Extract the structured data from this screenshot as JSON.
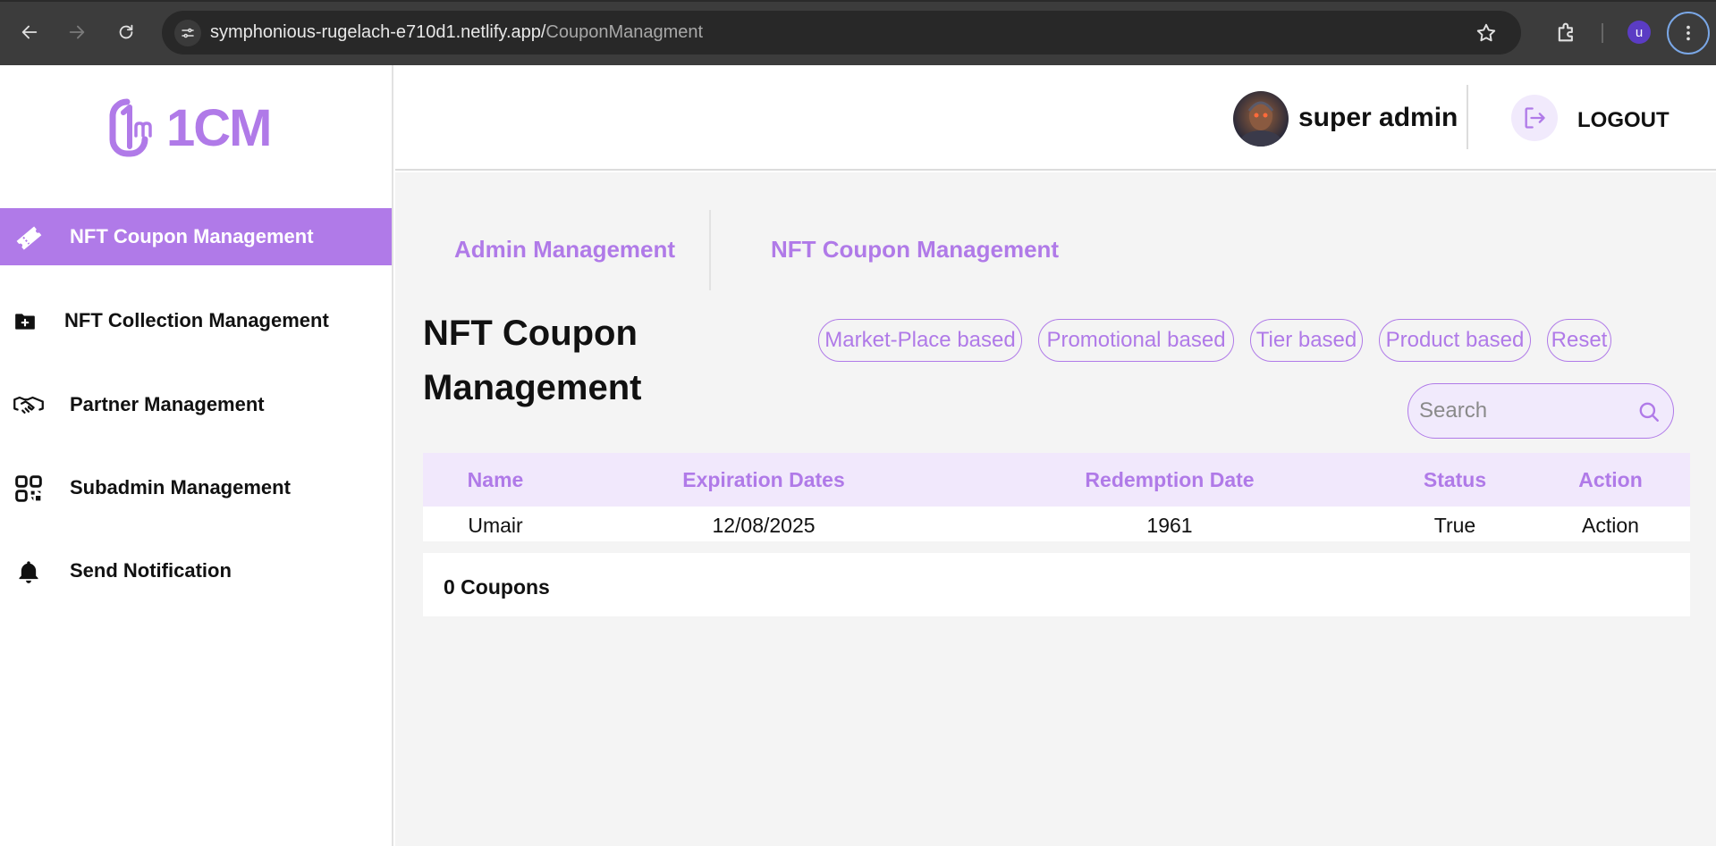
{
  "browser": {
    "url_host": "symphonious-rugelach-e710d1.netlify.app/",
    "url_path": "CouponManagment",
    "profile_initial": "u"
  },
  "logo": {
    "text": "1CM"
  },
  "sidebar": {
    "items": [
      {
        "label": "NFT Coupon Management",
        "icon": "ticket-icon",
        "active": true
      },
      {
        "label": "NFT Collection Management",
        "icon": "folder-plus-icon",
        "active": false
      },
      {
        "label": "Partner Management",
        "icon": "handshake-icon",
        "active": false
      },
      {
        "label": "Subadmin Management",
        "icon": "qr-code-icon",
        "active": false
      },
      {
        "label": "Send Notification",
        "icon": "bell-icon",
        "active": false
      }
    ]
  },
  "header": {
    "username": "super admin",
    "logout_label": "LOGOUT"
  },
  "tabs": [
    {
      "label": "Admin Management"
    },
    {
      "label": "NFT Coupon Management"
    }
  ],
  "page": {
    "title": "NFT Coupon Management",
    "filters": [
      "Market-Place based",
      "Promotional based",
      "Tier based",
      "Product based",
      "Reset"
    ],
    "search_placeholder": "Search"
  },
  "table": {
    "columns": [
      "Name",
      "Expiration Dates",
      "Redemption Date",
      "Status",
      "Action"
    ],
    "rows": [
      [
        "Umair",
        "12/08/2025",
        "1961",
        "True",
        "Action"
      ]
    ]
  },
  "footer": {
    "count_text": "0 Coupons"
  },
  "colors": {
    "accent": "#b07ae8",
    "accent_light": "#f1e8fc",
    "chrome": "#3c3c3c"
  }
}
